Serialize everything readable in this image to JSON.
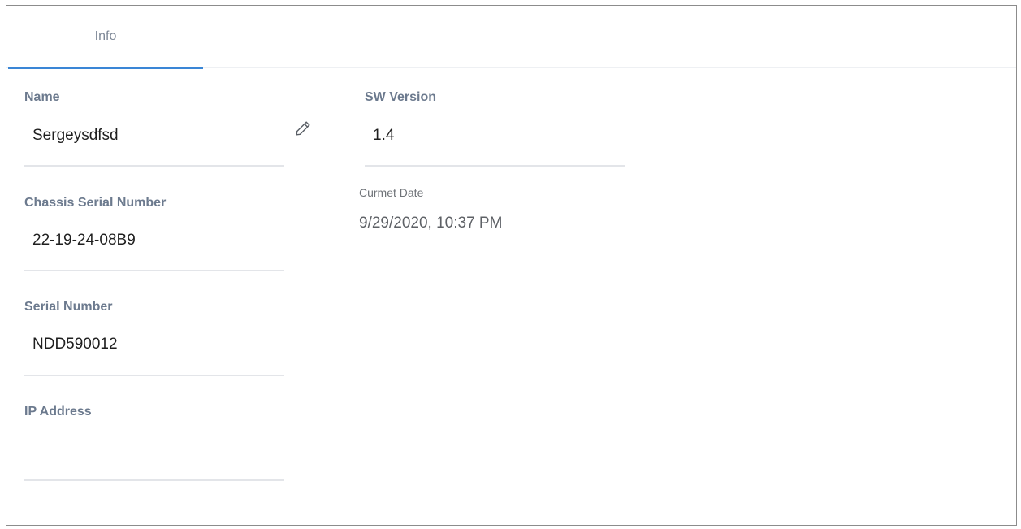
{
  "tabs": [
    {
      "label": "Info",
      "active": true
    }
  ],
  "fields": {
    "name": {
      "label": "Name",
      "value": "Sergeysdfsd"
    },
    "chassis_serial": {
      "label": "Chassis Serial Number",
      "value": "22-19-24-08B9"
    },
    "serial": {
      "label": "Serial Number",
      "value": "NDD590012"
    },
    "ip": {
      "label": "IP Address",
      "value": ""
    },
    "sw_version": {
      "label": "SW Version",
      "value": "1.4"
    },
    "current_date": {
      "label": "Curmet Date",
      "value": "9/29/2020, 10:37 PM"
    }
  },
  "icons": {
    "edit": "pencil-icon"
  },
  "colors": {
    "tab_indicator": "#3a86d6",
    "label": "#6c7a8e",
    "value": "#1f1f1f",
    "divider": "#e3e5e9"
  }
}
